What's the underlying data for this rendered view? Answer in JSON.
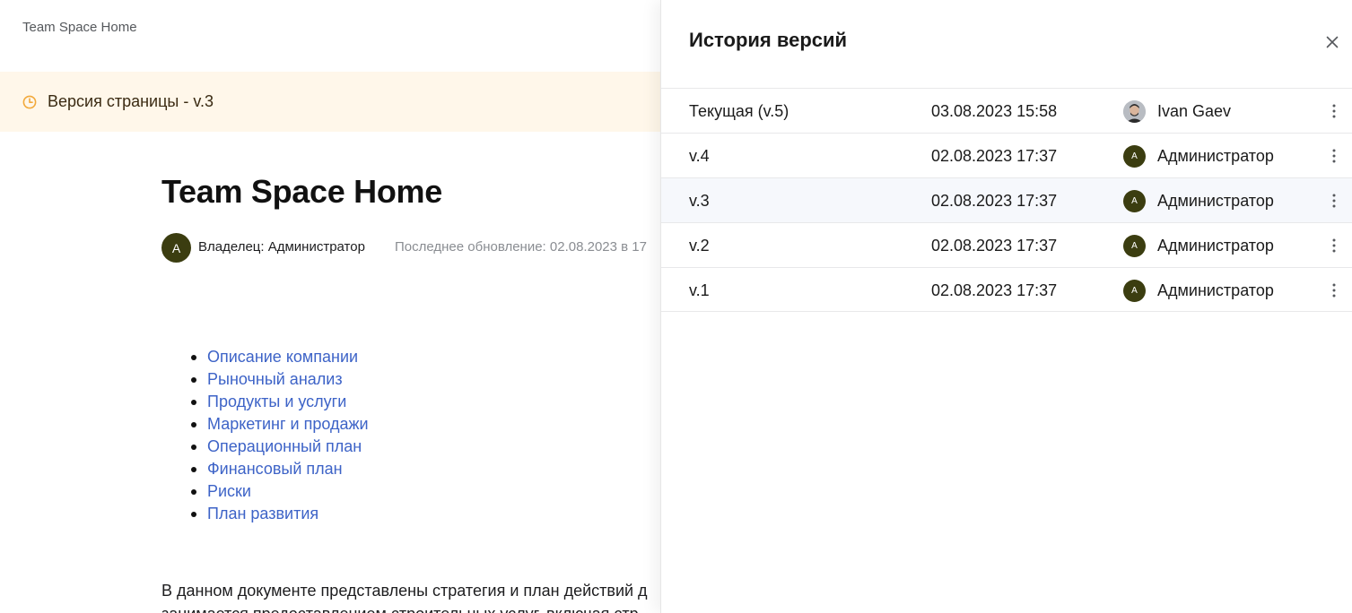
{
  "page": {
    "breadcrumb": "Team Space Home",
    "banner_text": "Версия страницы - v.3",
    "title": "Team Space Home",
    "owner_initial": "A",
    "owner_text": "Владелец: Администратор",
    "updated_text": "Последнее обновление: 02.08.2023 в 17",
    "toc": [
      "Описание компании",
      "Рыночный анализ",
      "Продукты и услуги",
      "Маркетинг и продажи",
      "Операционный план",
      "Финансовый план",
      "Риски",
      "План развития"
    ],
    "paragraph_line1": "В данном документе представлены стратегия и план действий д",
    "paragraph_line2": "занимается предоставлением строительных услуг, включая стр"
  },
  "panel": {
    "title": "История версий",
    "versions": [
      {
        "label": "Текущая (v.5)",
        "date": "03.08.2023 15:58",
        "author": "Ivan Gaev",
        "avatar": "photo",
        "initial": ""
      },
      {
        "label": "v.4",
        "date": "02.08.2023 17:37",
        "author": "Администратор",
        "avatar": "initial",
        "initial": "A"
      },
      {
        "label": "v.3",
        "date": "02.08.2023 17:37",
        "author": "Администратор",
        "avatar": "initial",
        "initial": "A",
        "selected": true
      },
      {
        "label": "v.2",
        "date": "02.08.2023 17:37",
        "author": "Администратор",
        "avatar": "initial",
        "initial": "A"
      },
      {
        "label": "v.1",
        "date": "02.08.2023 17:37",
        "author": "Администратор",
        "avatar": "initial",
        "initial": "A"
      }
    ]
  },
  "colors": {
    "banner_bg": "#fff7ea",
    "clock_icon": "#f2a93b",
    "link": "#3d63c7",
    "avatar_bg": "#3b3d10",
    "selected_row_bg": "#f6f8fc"
  },
  "icons": {
    "banner": "clock-icon",
    "close": "close-icon",
    "row_menu": "more-vertical-icon"
  }
}
